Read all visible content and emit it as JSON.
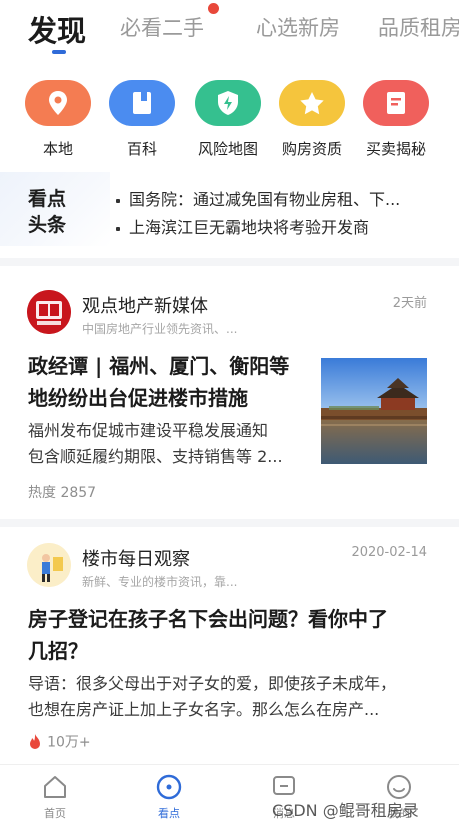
{
  "tabs": [
    {
      "label": "发现"
    },
    {
      "label": "必看二手"
    },
    {
      "label": "心选新房"
    },
    {
      "label": "品质租房"
    }
  ],
  "quick_entries": [
    {
      "label": "本地",
      "icon": "location-pin-icon",
      "color": "#f47c52"
    },
    {
      "label": "百科",
      "icon": "book-icon",
      "color": "#4b8cf0"
    },
    {
      "label": "风险地图",
      "icon": "shield-lightning-icon",
      "color": "#35c08f"
    },
    {
      "label": "购房资质",
      "icon": "star-icon",
      "color": "#f5c53d"
    },
    {
      "label": "买卖揭秘",
      "icon": "document-icon",
      "color": "#f0605c"
    }
  ],
  "headlines": {
    "tag_line1": "看点",
    "tag_line2": "头条",
    "items": [
      "国务院：通过减免国有物业房租、下...",
      "上海滨江巨无霸地块将考验开发商"
    ]
  },
  "articles": [
    {
      "source": "观点地产新媒体",
      "source_desc": "中国房地产行业领先资讯、...",
      "time": "2天前",
      "title_line1": "政经谭 | 福州、厦门、衡阳等",
      "title_line2": "地纷纷出台促进楼市措施",
      "desc_line1": "福州发布促城市建设平稳发展通知",
      "desc_line2": "包含顺延履约期限、支持销售等 2...",
      "stat": "热度 2857"
    },
    {
      "source": "楼市每日观察",
      "source_desc": "新鲜、专业的楼市资讯，靠...",
      "time": "2020-02-14",
      "title_line1": "房子登记在孩子名下会出问题？看你中了",
      "title_line2": "几招？",
      "desc_line1": "导语：很多父母出于对子女的爱，即使孩子未成年，",
      "desc_line2": "也想在房产证上加上子女名字。那么怎么在房产...",
      "stat": "10万+"
    }
  ],
  "bottom_nav": [
    {
      "label": "首页",
      "icon": "home-icon"
    },
    {
      "label": "看点",
      "icon": "compass-icon"
    },
    {
      "label": "消息",
      "icon": "message-icon"
    },
    {
      "label": "我的",
      "icon": "smiley-icon"
    }
  ],
  "watermark": "CSDN @鲲哥租房录",
  "colors": {
    "accent": "#2f6bd8",
    "notification_dot": "#e8483a",
    "hot_flame": "#e9483b"
  }
}
